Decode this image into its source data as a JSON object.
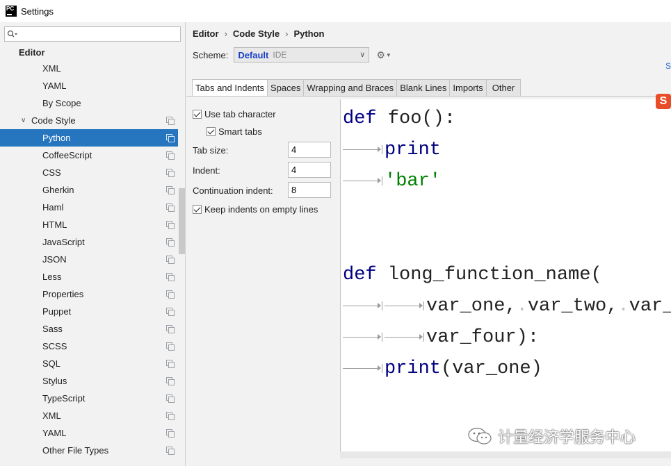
{
  "window": {
    "title": "Settings",
    "app_icon_text": "PC"
  },
  "search": {
    "value": "",
    "placeholder": ""
  },
  "tree": {
    "section": "Editor",
    "items_before": [
      "XML",
      "YAML",
      "By Scope"
    ],
    "group": "Code Style",
    "selected": "Python",
    "languages": [
      "CoffeeScript",
      "CSS",
      "Gherkin",
      "Haml",
      "HTML",
      "JavaScript",
      "JSON",
      "Less",
      "Properties",
      "Puppet",
      "Sass",
      "SCSS",
      "SQL",
      "Stylus",
      "TypeScript",
      "XML",
      "YAML",
      "Other File Types"
    ]
  },
  "breadcrumb": [
    "Editor",
    "Code Style",
    "Python"
  ],
  "scheme": {
    "label": "Scheme:",
    "name": "Default",
    "scope": "IDE"
  },
  "link_right": "S",
  "tabs": [
    "Tabs and Indents",
    "Spaces",
    "Wrapping and Braces",
    "Blank Lines",
    "Imports",
    "Other"
  ],
  "active_tab": "Tabs and Indents",
  "options": {
    "use_tab_character": {
      "label": "Use tab character",
      "checked": true
    },
    "smart_tabs": {
      "label": "Smart tabs",
      "checked": true
    },
    "tab_size": {
      "label": "Tab size:",
      "value": "4"
    },
    "indent": {
      "label": "Indent:",
      "value": "4"
    },
    "continuation_indent": {
      "label": "Continuation indent:",
      "value": "8"
    },
    "keep_indents": {
      "label": "Keep indents on empty lines",
      "checked": true
    }
  },
  "code": {
    "l1_kw": "def",
    "l1_rest": " foo():",
    "l2_kw": "print",
    "l3_str": "'bar'",
    "l5_kw": "def",
    "l5_rest": " long_function_name(",
    "l6_a": "var_one,",
    "l6_b": "var_two,",
    "l6_c": "var_th",
    "l7": "var_four):",
    "l8_kw": "print",
    "l8_rest": "(var_one)"
  },
  "ime_badge": "S",
  "watermark": "计量经济学服务中心",
  "colors": {
    "selection": "#2675bf",
    "keyword": "#000080",
    "string": "#008000",
    "scheme_name": "#1a3fc9"
  }
}
